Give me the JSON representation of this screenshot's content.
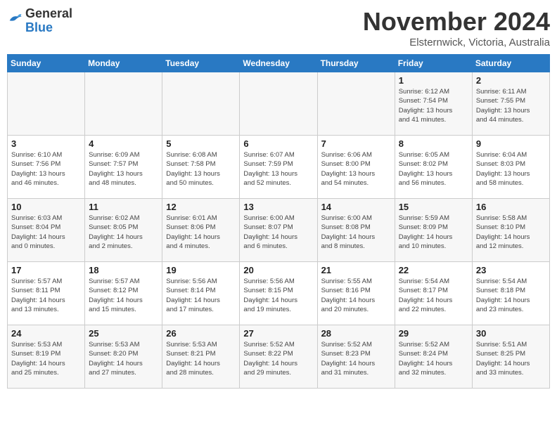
{
  "header": {
    "logo_general": "General",
    "logo_blue": "Blue",
    "title": "November 2024",
    "subtitle": "Elsternwick, Victoria, Australia"
  },
  "weekdays": [
    "Sunday",
    "Monday",
    "Tuesday",
    "Wednesday",
    "Thursday",
    "Friday",
    "Saturday"
  ],
  "weeks": [
    [
      {
        "day": "",
        "info": ""
      },
      {
        "day": "",
        "info": ""
      },
      {
        "day": "",
        "info": ""
      },
      {
        "day": "",
        "info": ""
      },
      {
        "day": "",
        "info": ""
      },
      {
        "day": "1",
        "info": "Sunrise: 6:12 AM\nSunset: 7:54 PM\nDaylight: 13 hours\nand 41 minutes."
      },
      {
        "day": "2",
        "info": "Sunrise: 6:11 AM\nSunset: 7:55 PM\nDaylight: 13 hours\nand 44 minutes."
      }
    ],
    [
      {
        "day": "3",
        "info": "Sunrise: 6:10 AM\nSunset: 7:56 PM\nDaylight: 13 hours\nand 46 minutes."
      },
      {
        "day": "4",
        "info": "Sunrise: 6:09 AM\nSunset: 7:57 PM\nDaylight: 13 hours\nand 48 minutes."
      },
      {
        "day": "5",
        "info": "Sunrise: 6:08 AM\nSunset: 7:58 PM\nDaylight: 13 hours\nand 50 minutes."
      },
      {
        "day": "6",
        "info": "Sunrise: 6:07 AM\nSunset: 7:59 PM\nDaylight: 13 hours\nand 52 minutes."
      },
      {
        "day": "7",
        "info": "Sunrise: 6:06 AM\nSunset: 8:00 PM\nDaylight: 13 hours\nand 54 minutes."
      },
      {
        "day": "8",
        "info": "Sunrise: 6:05 AM\nSunset: 8:02 PM\nDaylight: 13 hours\nand 56 minutes."
      },
      {
        "day": "9",
        "info": "Sunrise: 6:04 AM\nSunset: 8:03 PM\nDaylight: 13 hours\nand 58 minutes."
      }
    ],
    [
      {
        "day": "10",
        "info": "Sunrise: 6:03 AM\nSunset: 8:04 PM\nDaylight: 14 hours\nand 0 minutes."
      },
      {
        "day": "11",
        "info": "Sunrise: 6:02 AM\nSunset: 8:05 PM\nDaylight: 14 hours\nand 2 minutes."
      },
      {
        "day": "12",
        "info": "Sunrise: 6:01 AM\nSunset: 8:06 PM\nDaylight: 14 hours\nand 4 minutes."
      },
      {
        "day": "13",
        "info": "Sunrise: 6:00 AM\nSunset: 8:07 PM\nDaylight: 14 hours\nand 6 minutes."
      },
      {
        "day": "14",
        "info": "Sunrise: 6:00 AM\nSunset: 8:08 PM\nDaylight: 14 hours\nand 8 minutes."
      },
      {
        "day": "15",
        "info": "Sunrise: 5:59 AM\nSunset: 8:09 PM\nDaylight: 14 hours\nand 10 minutes."
      },
      {
        "day": "16",
        "info": "Sunrise: 5:58 AM\nSunset: 8:10 PM\nDaylight: 14 hours\nand 12 minutes."
      }
    ],
    [
      {
        "day": "17",
        "info": "Sunrise: 5:57 AM\nSunset: 8:11 PM\nDaylight: 14 hours\nand 13 minutes."
      },
      {
        "day": "18",
        "info": "Sunrise: 5:57 AM\nSunset: 8:12 PM\nDaylight: 14 hours\nand 15 minutes."
      },
      {
        "day": "19",
        "info": "Sunrise: 5:56 AM\nSunset: 8:14 PM\nDaylight: 14 hours\nand 17 minutes."
      },
      {
        "day": "20",
        "info": "Sunrise: 5:56 AM\nSunset: 8:15 PM\nDaylight: 14 hours\nand 19 minutes."
      },
      {
        "day": "21",
        "info": "Sunrise: 5:55 AM\nSunset: 8:16 PM\nDaylight: 14 hours\nand 20 minutes."
      },
      {
        "day": "22",
        "info": "Sunrise: 5:54 AM\nSunset: 8:17 PM\nDaylight: 14 hours\nand 22 minutes."
      },
      {
        "day": "23",
        "info": "Sunrise: 5:54 AM\nSunset: 8:18 PM\nDaylight: 14 hours\nand 23 minutes."
      }
    ],
    [
      {
        "day": "24",
        "info": "Sunrise: 5:53 AM\nSunset: 8:19 PM\nDaylight: 14 hours\nand 25 minutes."
      },
      {
        "day": "25",
        "info": "Sunrise: 5:53 AM\nSunset: 8:20 PM\nDaylight: 14 hours\nand 27 minutes."
      },
      {
        "day": "26",
        "info": "Sunrise: 5:53 AM\nSunset: 8:21 PM\nDaylight: 14 hours\nand 28 minutes."
      },
      {
        "day": "27",
        "info": "Sunrise: 5:52 AM\nSunset: 8:22 PM\nDaylight: 14 hours\nand 29 minutes."
      },
      {
        "day": "28",
        "info": "Sunrise: 5:52 AM\nSunset: 8:23 PM\nDaylight: 14 hours\nand 31 minutes."
      },
      {
        "day": "29",
        "info": "Sunrise: 5:52 AM\nSunset: 8:24 PM\nDaylight: 14 hours\nand 32 minutes."
      },
      {
        "day": "30",
        "info": "Sunrise: 5:51 AM\nSunset: 8:25 PM\nDaylight: 14 hours\nand 33 minutes."
      }
    ]
  ]
}
